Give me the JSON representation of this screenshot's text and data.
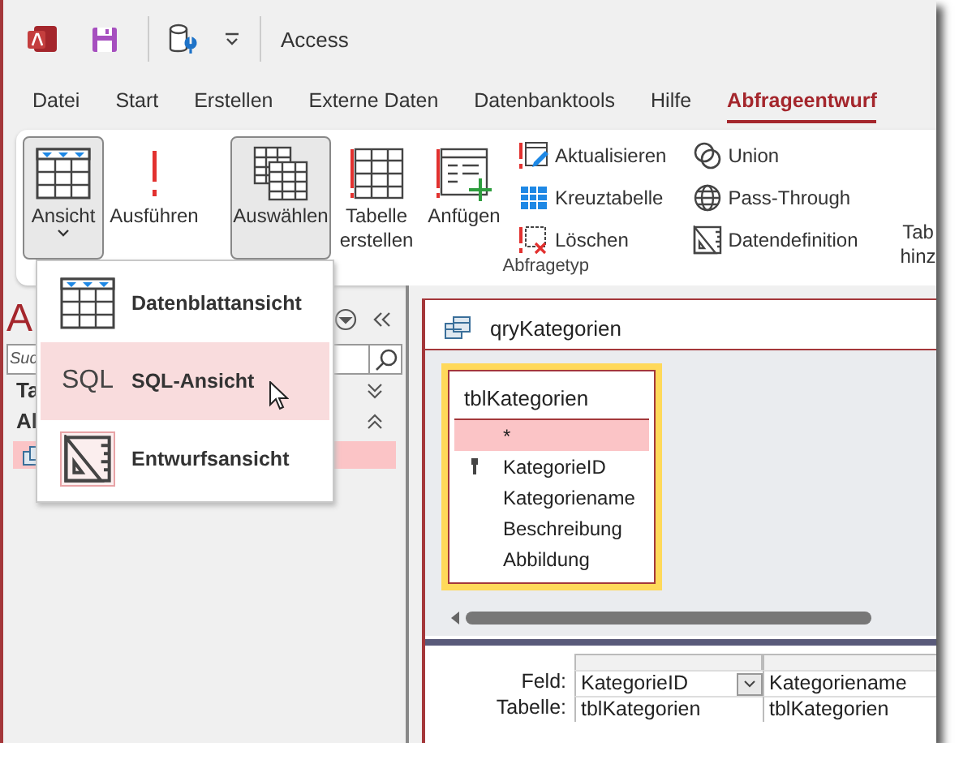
{
  "title_bar": {
    "app_name": "Access"
  },
  "tabs": [
    {
      "label": "Datei",
      "selected": false
    },
    {
      "label": "Start",
      "selected": false
    },
    {
      "label": "Erstellen",
      "selected": false
    },
    {
      "label": "Externe Daten",
      "selected": false
    },
    {
      "label": "Datenbanktools",
      "selected": false
    },
    {
      "label": "Hilfe",
      "selected": false
    },
    {
      "label": "Abfrageentwurf",
      "selected": true
    }
  ],
  "ribbon": {
    "view_buttons": [
      {
        "label": "Ansicht",
        "pressed": true,
        "dropdown": true
      },
      {
        "label": "Ausführen",
        "pressed": false,
        "dropdown": false
      }
    ],
    "query_type_buttons": [
      {
        "label": "Auswählen",
        "pressed": true
      },
      {
        "label": "Tabelle erstellen",
        "pressed": false
      },
      {
        "label": "Anfügen",
        "pressed": false
      }
    ],
    "small_buttons": [
      {
        "label": "Aktualisieren"
      },
      {
        "label": "Kreuztabelle"
      },
      {
        "label": "Löschen"
      },
      {
        "label": "Union"
      },
      {
        "label": "Pass-Through"
      },
      {
        "label": "Datendefinition"
      }
    ],
    "group_label": "Abfragetyp",
    "cut_button": {
      "label": "Tab hinz"
    }
  },
  "navigation": {
    "title": "A",
    "search": {
      "placeholder": "Suc"
    },
    "groups": [
      {
        "label": "Ta",
        "expanded": false
      },
      {
        "label": "Al",
        "expanded": true
      }
    ],
    "items": [
      {
        "selected": true
      }
    ]
  },
  "view_menu": {
    "items": [
      {
        "label": "Datenblattansicht",
        "selected": false,
        "current": false
      },
      {
        "label": "SQL-Ansicht",
        "icon_text": "SQL",
        "selected": true,
        "current": false
      },
      {
        "label": "Entwurfsansicht",
        "selected": false,
        "current": true
      }
    ]
  },
  "query": {
    "title": "qryKategorien",
    "table": {
      "name": "tblKategorien",
      "fields": [
        {
          "name": "*",
          "selected": true,
          "primary_key": false
        },
        {
          "name": "KategorieID",
          "selected": false,
          "primary_key": true
        },
        {
          "name": "Kategoriename",
          "selected": false,
          "primary_key": false
        },
        {
          "name": "Beschreibung",
          "selected": false,
          "primary_key": false
        },
        {
          "name": "Abbildung",
          "selected": false,
          "primary_key": false
        }
      ]
    },
    "grid": {
      "row_labels": [
        "Feld:",
        "Tabelle:"
      ],
      "columns": [
        {
          "field": "KategorieID",
          "table": "tblKategorien",
          "dropdown": true
        },
        {
          "field": "Kategoriename",
          "table": "tblKategorien",
          "dropdown": false
        }
      ]
    }
  }
}
